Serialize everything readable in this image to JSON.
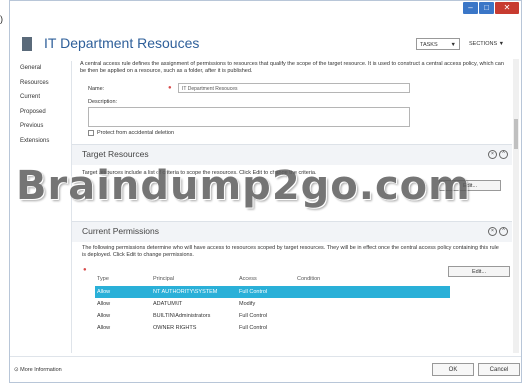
{
  "window": {
    "left_edge_char": ")",
    "controls": {
      "minimize": "–",
      "maximize": "□",
      "close": "✕"
    }
  },
  "header": {
    "title": "IT Department Resouces",
    "tasks_label": "TASKS",
    "sections_label": "SECTIONS"
  },
  "sidebar": {
    "items": [
      {
        "label": "General"
      },
      {
        "label": "Resources"
      },
      {
        "label": "Current"
      },
      {
        "label": "Proposed"
      },
      {
        "label": "Previous"
      },
      {
        "label": "Extensions"
      }
    ]
  },
  "general": {
    "description": "A central access rule defines the assignment of permissions to resources that qualify the scope of the target resource. It is used to construct a central access policy, which can be then be applied on a resource, such as a folder, after it is published.",
    "name_label": "Name:",
    "name_value": "IT Department Resouces",
    "description_label": "Description:",
    "protect_label": "Protect from accidental deletion"
  },
  "target_resources": {
    "title": "Target Resources",
    "text": "Target resources include a list of criteria to scope the resources. Click Edit to change the criteria.",
    "edit_label": "Edit..."
  },
  "watermark": "Braindump2go.com",
  "current_permissions": {
    "title": "Current Permissions",
    "text": "The following permissions determine who will have access to resources scoped by target resources. They will be in effect once the central access policy containing this rule is deployed. Click Edit to change permissions.",
    "edit_label": "Edit...",
    "columns": [
      "Type",
      "Principal",
      "Access",
      "Condition"
    ],
    "rows": [
      {
        "type": "Allow",
        "principal": "NT AUTHORITY\\SYSTEM",
        "access": "Full Control",
        "condition": "",
        "selected": true
      },
      {
        "type": "Allow",
        "principal": "ADATUM\\IT",
        "access": "Modify",
        "condition": ""
      },
      {
        "type": "Allow",
        "principal": "BUILTIN\\Administrators",
        "access": "Full Control",
        "condition": ""
      },
      {
        "type": "Allow",
        "principal": "OWNER RIGHTS",
        "access": "Full Control",
        "condition": ""
      }
    ]
  },
  "footer": {
    "more_info": "More Information",
    "ok": "OK",
    "cancel": "Cancel"
  },
  "colors": {
    "title": "#2e5f9a",
    "selected_row": "#2ab0d8",
    "close_button": "#c73b30",
    "window_buttons": "#3a76c7"
  }
}
